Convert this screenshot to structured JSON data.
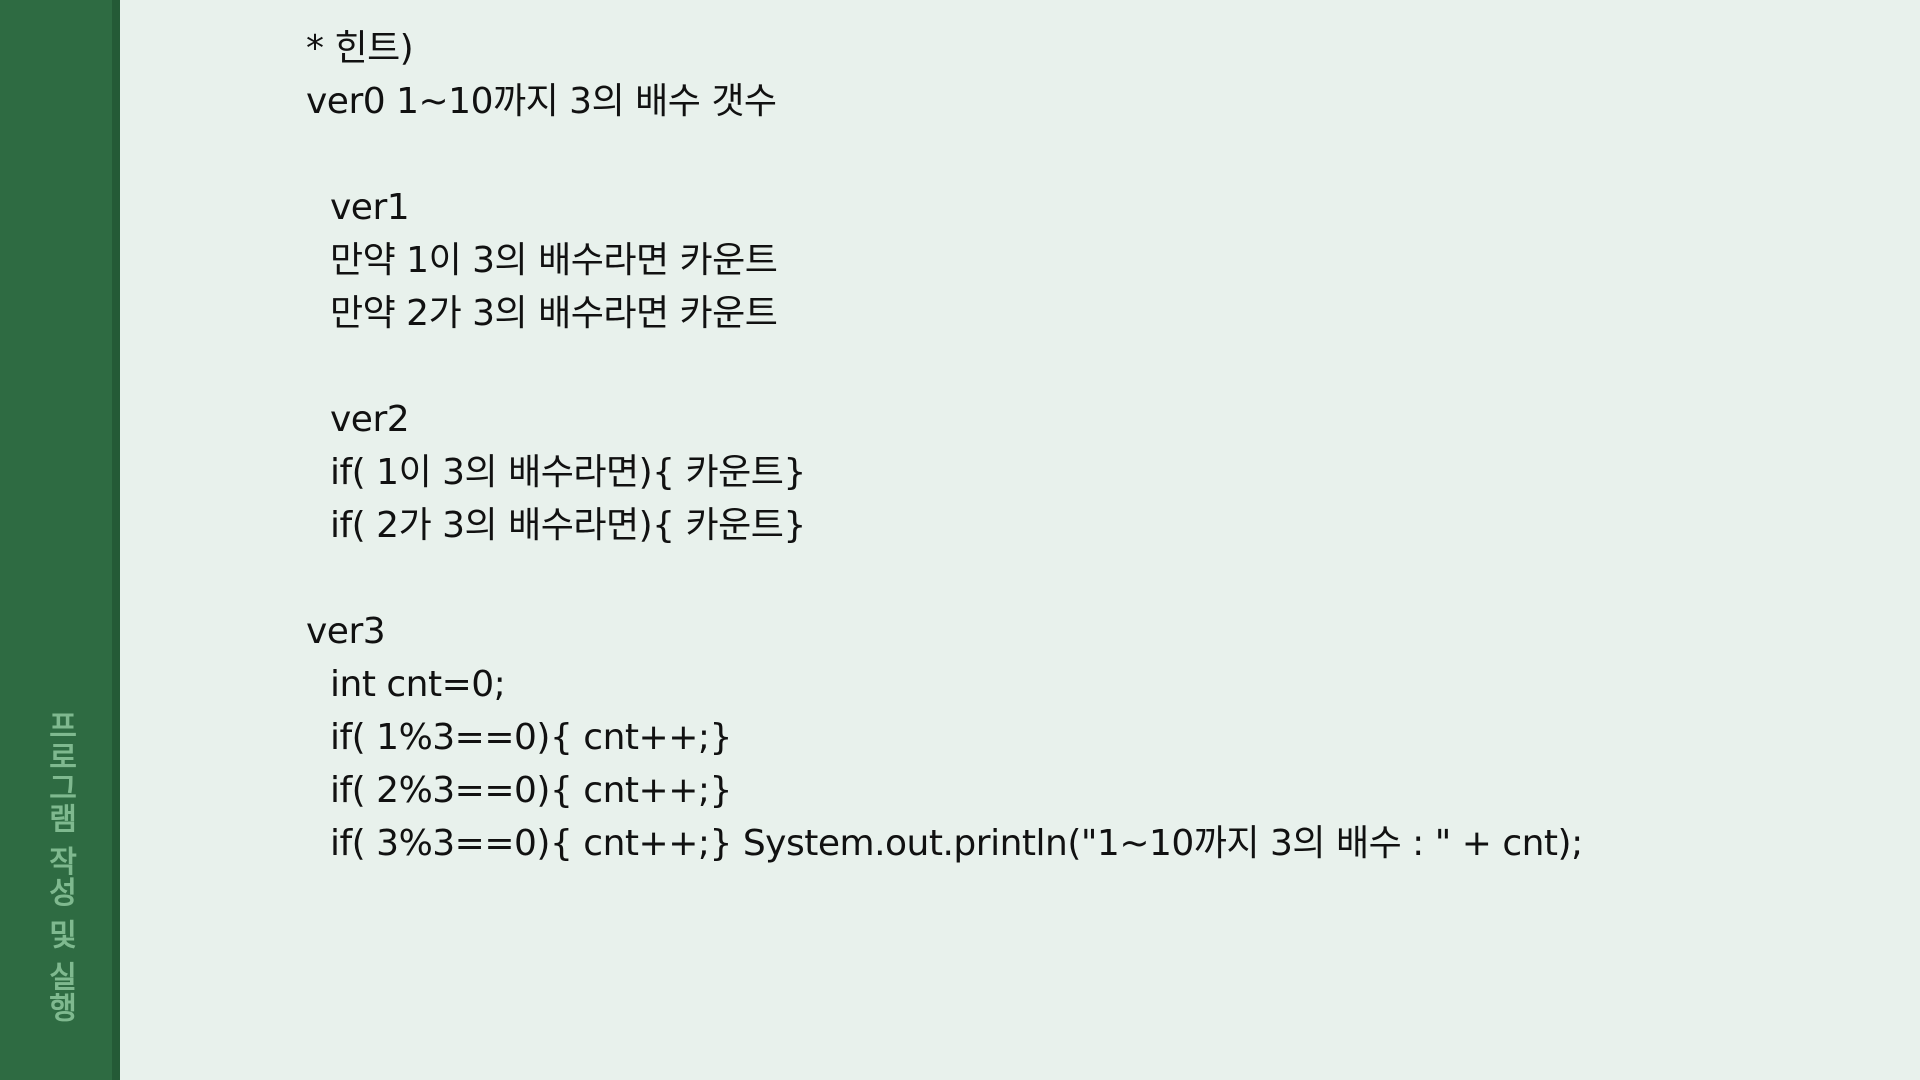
{
  "sidebar": {
    "title": "프로그램 작성 및 실행"
  },
  "content": {
    "hint_title": "* 힌트)",
    "ver0": "ver0 1~10까지 3의 배수 갯수",
    "ver1": {
      "label": "ver1",
      "lines": [
        "만약 1이 3의 배수라면 카운트",
        "만약 2가 3의 배수라면 카운트"
      ]
    },
    "ver2": {
      "label": "ver2",
      "lines": [
        "if( 1이 3의 배수라면){ 카운트}",
        "if( 2가 3의 배수라면){ 카운트}"
      ]
    },
    "ver3": {
      "label": "ver3",
      "lines": [
        "int cnt=0;",
        "if( 1%3==0){ cnt++;}",
        "if( 2%3==0){ cnt++;}",
        "if( 3%3==0){ cnt++;} System.out.println(\"1~10까지 3의 배수 : \" + cnt);"
      ]
    }
  },
  "colors": {
    "sidebar": "#2e6b42",
    "sidebar_edge": "#245a36",
    "sidebar_text": "#7fb98f",
    "background": "#e8f1ec",
    "text": "#111111"
  }
}
